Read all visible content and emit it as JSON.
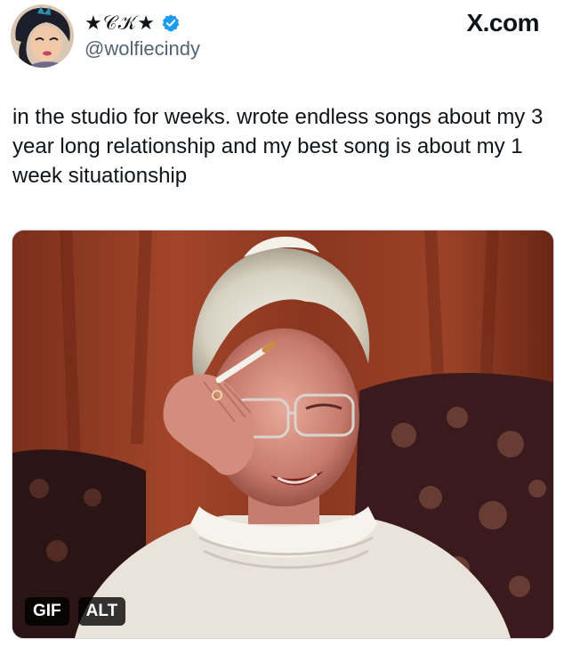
{
  "header": {
    "display_name": "★𝒞𝒦★",
    "handle": "@wolfiecindy",
    "brand": "X.com",
    "verified_color": "#1d9bf0"
  },
  "tweet": {
    "text": "in the studio for weeks. wrote endless songs about my 3 year long relationship and my best song is about my 1 week situationship"
  },
  "media": {
    "gif_badge": "GIF",
    "alt_badge": "ALT"
  },
  "colors": {
    "text_primary": "#0f1419",
    "text_secondary": "#536471",
    "badge_bg": "#000000"
  }
}
